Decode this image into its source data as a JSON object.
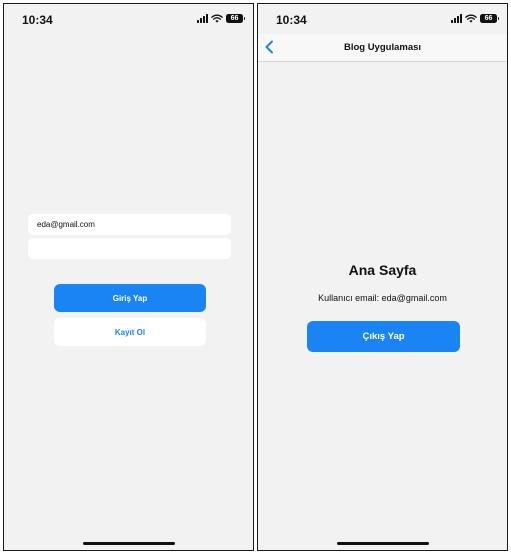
{
  "login_screen": {
    "status_bar": {
      "time": "10:34",
      "battery": "66"
    },
    "email_input": {
      "value": "eda@gmail.com"
    },
    "password_input": {
      "value": ""
    },
    "login_button": "Giriş Yap",
    "register_button": "Kayıt Ol"
  },
  "home_screen": {
    "status_bar": {
      "time": "10:34",
      "battery": "66"
    },
    "nav_title": "Blog Uygulaması",
    "title": "Ana Sayfa",
    "user_email_text": "Kullanıcı email: eda@gmail.com",
    "logout_button": "Çıkış Yap"
  },
  "colors": {
    "accent": "#1a84f5",
    "background": "#f2f2f2",
    "surface": "#ffffff"
  },
  "icons": [
    "cellular-signal-icon",
    "wifi-icon",
    "battery-icon",
    "back-chevron-icon"
  ]
}
